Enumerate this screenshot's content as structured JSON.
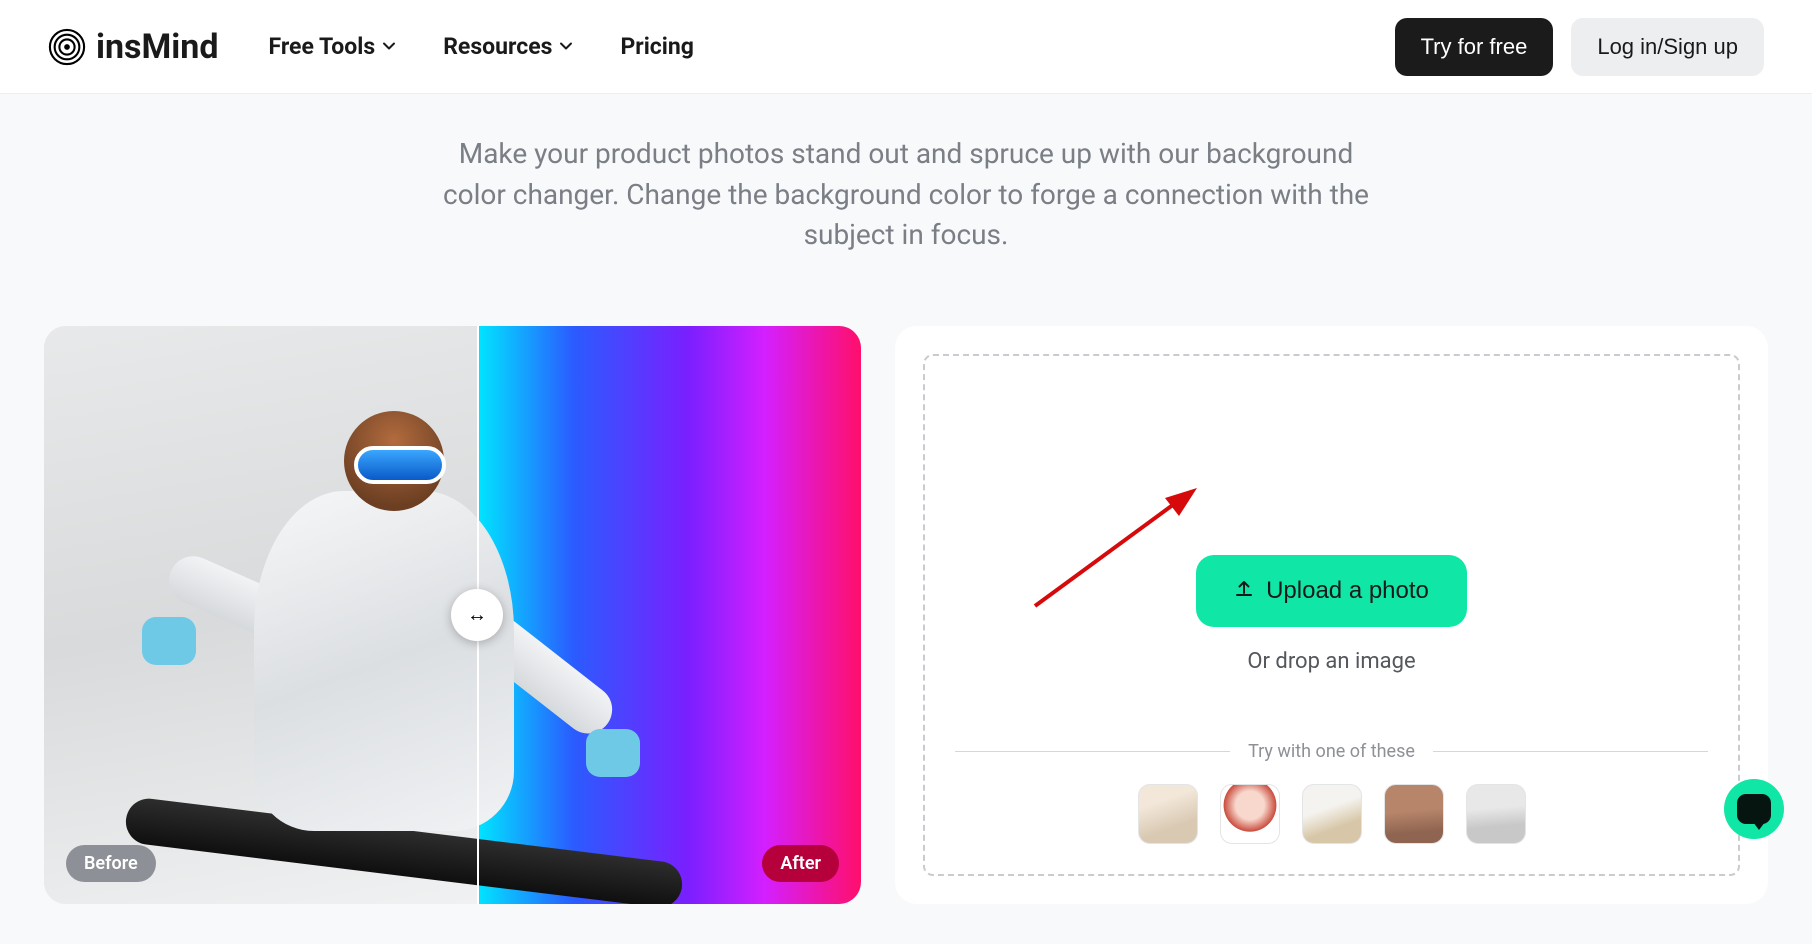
{
  "brand": "insMind",
  "nav": [
    {
      "label": "Free Tools",
      "hasDropdown": true
    },
    {
      "label": "Resources",
      "hasDropdown": true
    },
    {
      "label": "Pricing",
      "hasDropdown": false
    }
  ],
  "actions": {
    "try": "Try for free",
    "login": "Log in/Sign up"
  },
  "description": "Make your product photos stand out and spruce up with our background color changer. Change the background color to forge a connection with the subject in focus.",
  "compare": {
    "before_label": "Before",
    "after_label": "After"
  },
  "upload": {
    "button": "Upload a photo",
    "drop_text": "Or drop an image",
    "try_label": "Try with one of these",
    "samples": [
      "cosmetics",
      "portrait-woman",
      "handbag",
      "tall-bottle",
      "cat"
    ]
  },
  "colors": {
    "accent": "#10e6a6",
    "dark_button": "#1b1b1b",
    "text_muted": "#7a7e85",
    "annotation_arrow": "#d60a0a"
  }
}
